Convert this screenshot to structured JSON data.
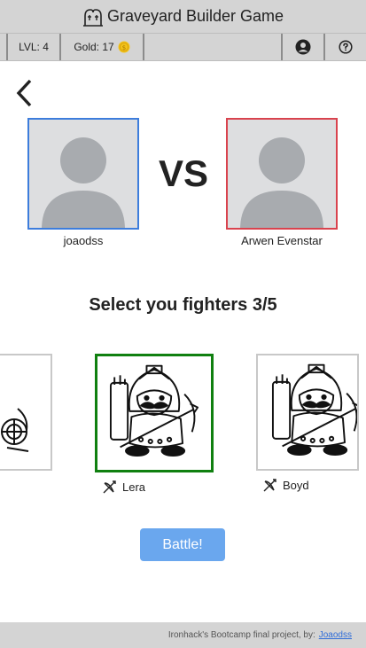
{
  "header": {
    "title": "Graveyard Builder Game",
    "icon": "tombstone-icon"
  },
  "status": {
    "level_label": "LVL: 4",
    "gold_label": "Gold: 17",
    "coin_icon": "coin-icon",
    "profile_icon": "user-circle-icon",
    "help_icon": "help-circle-icon"
  },
  "back_icon": "chevron-left-icon",
  "match": {
    "vs_label": "VS",
    "player1": {
      "name": "joaodss",
      "border_color": "#3d7ddc"
    },
    "player2": {
      "name": "Arwen Evenstar",
      "border_color": "#d9434e"
    }
  },
  "selection": {
    "title": "Select you fighters 3/5"
  },
  "fighters": [
    {
      "name": "",
      "class_icon": ""
    },
    {
      "name": "Lera",
      "class_icon": "bow-icon",
      "selected": true
    },
    {
      "name": "Boyd",
      "class_icon": "bow-icon"
    }
  ],
  "battle_button": {
    "label": "Battle!",
    "color": "#6aa7ee"
  },
  "footer": {
    "text": "Ironhack's Bootcamp final project, by:",
    "link": "Joaodss"
  },
  "colors": {
    "bar": "#d4d4d4",
    "selected": "#108010"
  }
}
